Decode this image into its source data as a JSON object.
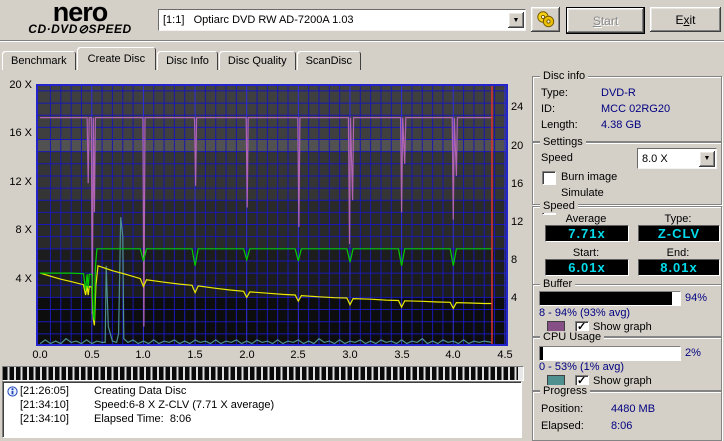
{
  "header": {
    "logo_line1": "nero",
    "logo_line2": "CD·DVD⊘SPEED",
    "drive_select_value": "[1:1]   Optiarc DVD RW AD-7200A 1.03",
    "start_parts": [
      "S",
      "tart"
    ],
    "exit_parts": [
      "E",
      "x",
      "it"
    ]
  },
  "tabs": {
    "active": "Create Disc",
    "items": [
      {
        "label": "Benchmark"
      },
      {
        "label": "Create Disc"
      },
      {
        "label": "Disc Info"
      },
      {
        "label": "Disc Quality"
      },
      {
        "label": "ScanDisc"
      }
    ]
  },
  "chart_data": {
    "type": "line",
    "x_axis": {
      "unit": "GB",
      "tick_labels": [
        "0.0",
        "0.5",
        "1.0",
        "1.5",
        "2.0",
        "2.5",
        "3.0",
        "3.5",
        "4.0",
        "4.5"
      ]
    },
    "y_left": {
      "tick_labels": [
        "20 X",
        "16 X",
        "12 X",
        "8 X",
        "4 X"
      ]
    },
    "y_right": {
      "tick_labels": [
        "24",
        "20",
        "16",
        "12",
        "8",
        "4"
      ]
    },
    "xlim": [
      -0.04,
      4.53
    ],
    "ylim": [
      0,
      21.57
    ],
    "grid": true,
    "position_marker_gb": 4.375,
    "marker_color": "#dd3333",
    "written_bar_percent": 99,
    "bands": [
      {
        "from": 21.57,
        "to": 17,
        "color": "#3f3f3f"
      },
      {
        "from": 17,
        "to": 16,
        "color": "#515151"
      },
      {
        "from": 16,
        "to": 12,
        "color": "#353535"
      },
      {
        "from": 12,
        "to": 8,
        "color": "#2a2a2a"
      },
      {
        "from": 8,
        "to": 4,
        "color": "#1d1d1d"
      },
      {
        "from": 4,
        "to": 0,
        "color": "#0d0d0d"
      }
    ],
    "series": [
      {
        "name": "buffer-level",
        "unit": "percent",
        "color": "#b164b1",
        "points": [
          [
            0,
            94
          ],
          [
            0.455,
            94
          ],
          [
            0.465,
            67
          ],
          [
            0.475,
            94
          ],
          [
            0.495,
            94
          ],
          [
            0.505,
            13
          ],
          [
            0.515,
            94
          ],
          [
            0.525,
            55
          ],
          [
            0.535,
            94
          ],
          [
            0.995,
            94
          ],
          [
            1.005,
            8
          ],
          [
            1.015,
            94
          ],
          [
            1.495,
            94
          ],
          [
            1.505,
            66
          ],
          [
            1.515,
            94
          ],
          [
            1.995,
            94
          ],
          [
            2.005,
            57
          ],
          [
            2.015,
            94
          ],
          [
            2.495,
            94
          ],
          [
            2.505,
            49
          ],
          [
            2.515,
            94
          ],
          [
            2.985,
            94
          ],
          [
            2.995,
            42
          ],
          [
            3.005,
            94
          ],
          [
            3.025,
            60
          ],
          [
            3.035,
            94
          ],
          [
            3.49,
            94
          ],
          [
            3.5,
            55
          ],
          [
            3.51,
            94
          ],
          [
            3.53,
            75
          ],
          [
            3.54,
            94
          ],
          [
            3.99,
            94
          ],
          [
            4.0,
            52
          ],
          [
            4.01,
            94
          ],
          [
            4.03,
            70
          ],
          [
            4.04,
            94
          ],
          [
            4.375,
            94
          ]
        ]
      },
      {
        "name": "cpu-usage",
        "unit": "percent",
        "color": "#4e8f8f",
        "points": [
          [
            0,
            1
          ],
          [
            0.05,
            2.5
          ],
          [
            0.1,
            1
          ],
          [
            0.15,
            2
          ],
          [
            0.2,
            1
          ],
          [
            0.25,
            3
          ],
          [
            0.3,
            1.5
          ],
          [
            0.35,
            2
          ],
          [
            0.4,
            1
          ],
          [
            0.45,
            2.5
          ],
          [
            0.5,
            1
          ],
          [
            0.55,
            2
          ],
          [
            0.6,
            1.5
          ],
          [
            0.63,
            1.5
          ],
          [
            0.64,
            33
          ],
          [
            0.66,
            8
          ],
          [
            0.7,
            2
          ],
          [
            0.74,
            1.5
          ],
          [
            0.76,
            5
          ],
          [
            0.78,
            53
          ],
          [
            0.8,
            45
          ],
          [
            0.81,
            3
          ],
          [
            0.85,
            1.5
          ],
          [
            0.9,
            2.5
          ],
          [
            0.95,
            1
          ],
          [
            1.0,
            2
          ],
          [
            1.05,
            1
          ],
          [
            1.1,
            2.5
          ],
          [
            1.15,
            1
          ],
          [
            1.2,
            2
          ],
          [
            1.25,
            1.5
          ],
          [
            1.3,
            2.5
          ],
          [
            1.35,
            1
          ],
          [
            1.4,
            2
          ],
          [
            1.45,
            1
          ],
          [
            1.5,
            2.5
          ],
          [
            1.55,
            1.5
          ],
          [
            1.6,
            2
          ],
          [
            1.65,
            1
          ],
          [
            1.7,
            2.5
          ],
          [
            1.75,
            1
          ],
          [
            1.8,
            2
          ],
          [
            1.85,
            1.5
          ],
          [
            1.9,
            2.5
          ],
          [
            1.95,
            1
          ],
          [
            2.0,
            2
          ],
          [
            2.05,
            1
          ],
          [
            2.1,
            2.5
          ],
          [
            2.15,
            1.5
          ],
          [
            2.2,
            2
          ],
          [
            2.25,
            1
          ],
          [
            2.3,
            2.5
          ],
          [
            2.35,
            1
          ],
          [
            2.4,
            2
          ],
          [
            2.45,
            1.5
          ],
          [
            2.5,
            2.5
          ],
          [
            2.55,
            1
          ],
          [
            2.6,
            2
          ],
          [
            2.65,
            1
          ],
          [
            2.7,
            3
          ],
          [
            2.75,
            1.5
          ],
          [
            2.8,
            2
          ],
          [
            2.85,
            1
          ],
          [
            2.9,
            2.5
          ],
          [
            2.95,
            1
          ],
          [
            3.0,
            2
          ],
          [
            3.05,
            1.5
          ],
          [
            3.1,
            2.5
          ],
          [
            3.15,
            1
          ],
          [
            3.2,
            2
          ],
          [
            3.25,
            1
          ],
          [
            3.3,
            2.5
          ],
          [
            3.35,
            1.5
          ],
          [
            3.4,
            2
          ],
          [
            3.45,
            1
          ],
          [
            3.5,
            2.5
          ],
          [
            3.55,
            1
          ],
          [
            3.6,
            2
          ],
          [
            3.65,
            1.5
          ],
          [
            3.7,
            3
          ],
          [
            3.75,
            1
          ],
          [
            3.8,
            2
          ],
          [
            3.85,
            1
          ],
          [
            3.9,
            2.5
          ],
          [
            3.95,
            1.5
          ],
          [
            4.0,
            2
          ],
          [
            4.05,
            1
          ],
          [
            4.1,
            2.5
          ],
          [
            4.15,
            1
          ],
          [
            4.2,
            2
          ],
          [
            4.25,
            1.5
          ],
          [
            4.3,
            2
          ],
          [
            4.375,
            1.5
          ]
        ]
      },
      {
        "name": "average-rate",
        "unit": "x",
        "color": "#e8e800",
        "points": [
          [
            0,
            6.0
          ],
          [
            0.1,
            5.75
          ],
          [
            0.2,
            5.5
          ],
          [
            0.3,
            5.3
          ],
          [
            0.42,
            5.05
          ],
          [
            0.44,
            4.2
          ],
          [
            0.455,
            4.95
          ],
          [
            0.465,
            4.2
          ],
          [
            0.475,
            4.9
          ],
          [
            0.5,
            4.85
          ],
          [
            0.515,
            2.2
          ],
          [
            0.525,
            1.7
          ],
          [
            0.54,
            5.0
          ],
          [
            0.56,
            6.6
          ],
          [
            0.7,
            6.2
          ],
          [
            0.85,
            5.85
          ],
          [
            0.97,
            5.55
          ],
          [
            1.0,
            4.9
          ],
          [
            1.03,
            5.45
          ],
          [
            1.2,
            5.25
          ],
          [
            1.35,
            5.1
          ],
          [
            1.47,
            5.0
          ],
          [
            1.5,
            4.4
          ],
          [
            1.53,
            4.95
          ],
          [
            1.7,
            4.75
          ],
          [
            1.85,
            4.6
          ],
          [
            1.97,
            4.5
          ],
          [
            2.0,
            4.0
          ],
          [
            2.03,
            4.45
          ],
          [
            2.2,
            4.35
          ],
          [
            2.35,
            4.25
          ],
          [
            2.47,
            4.2
          ],
          [
            2.5,
            3.7
          ],
          [
            2.53,
            4.15
          ],
          [
            2.7,
            4.05
          ],
          [
            2.85,
            3.98
          ],
          [
            2.97,
            3.95
          ],
          [
            3.0,
            3.4
          ],
          [
            3.03,
            3.9
          ],
          [
            3.2,
            3.85
          ],
          [
            3.35,
            3.78
          ],
          [
            3.47,
            3.75
          ],
          [
            3.5,
            3.2
          ],
          [
            3.53,
            3.72
          ],
          [
            3.7,
            3.68
          ],
          [
            3.85,
            3.62
          ],
          [
            3.97,
            3.6
          ],
          [
            4.0,
            3.1
          ],
          [
            4.03,
            3.57
          ],
          [
            4.2,
            3.53
          ],
          [
            4.3,
            3.5
          ],
          [
            4.375,
            3.5
          ]
        ]
      },
      {
        "name": "write-speed",
        "unit": "x",
        "color": "#00cc00",
        "points": [
          [
            0,
            6.0
          ],
          [
            0.1,
            6.0
          ],
          [
            0.2,
            6.0
          ],
          [
            0.3,
            6.0
          ],
          [
            0.42,
            5.95
          ],
          [
            0.44,
            4.6
          ],
          [
            0.455,
            5.9
          ],
          [
            0.465,
            4.8
          ],
          [
            0.475,
            5.9
          ],
          [
            0.5,
            5.9
          ],
          [
            0.515,
            2.6
          ],
          [
            0.525,
            2.1
          ],
          [
            0.535,
            6.5
          ],
          [
            0.55,
            8.0
          ],
          [
            0.97,
            8.0
          ],
          [
            1.0,
            7.0
          ],
          [
            1.03,
            8.0
          ],
          [
            1.47,
            8.0
          ],
          [
            1.5,
            6.6
          ],
          [
            1.53,
            8.0
          ],
          [
            1.97,
            8.0
          ],
          [
            2.0,
            7.1
          ],
          [
            2.03,
            8.0
          ],
          [
            2.47,
            8.0
          ],
          [
            2.5,
            7.0
          ],
          [
            2.53,
            8.0
          ],
          [
            2.97,
            8.0
          ],
          [
            3.0,
            6.9
          ],
          [
            3.03,
            8.0
          ],
          [
            3.47,
            8.0
          ],
          [
            3.5,
            6.6
          ],
          [
            3.53,
            8.0
          ],
          [
            3.97,
            8.0
          ],
          [
            4.0,
            6.6
          ],
          [
            4.03,
            8.0
          ],
          [
            4.375,
            8.0
          ]
        ]
      }
    ]
  },
  "log": {
    "lines": [
      {
        "time": "[21:26:05]",
        "text": "Creating Data Disc"
      },
      {
        "time": "[21:34:10]",
        "text": "Speed:6-8 X Z-CLV (7.71 X average)"
      },
      {
        "time": "[21:34:10]",
        "text": "Elapsed Time:  8:06"
      }
    ]
  },
  "disc_info": {
    "title": "Disc info",
    "rows": [
      {
        "label": "Type:",
        "value": "DVD-R"
      },
      {
        "label": "ID:",
        "value": "MCC 02RG20"
      },
      {
        "label": "Length:",
        "value": "4.38 GB"
      }
    ]
  },
  "settings": {
    "title": "Settings",
    "speed_label": "Speed",
    "speed_value": "8.0 X",
    "checkboxes": [
      {
        "label": "Burn image",
        "checked": false
      },
      {
        "label": "Simulate",
        "checked": false
      }
    ]
  },
  "speed": {
    "title": "Speed",
    "average_label": "Average",
    "average_value": "7.71x",
    "type_label": "Type:",
    "type_value": "Z-CLV",
    "start_label": "Start:",
    "start_value": "6.01x",
    "end_label": "End:",
    "end_value": "8.01x"
  },
  "buffer": {
    "title": "Buffer",
    "percent": 94,
    "percent_label": "94%",
    "range_text": "8 - 94% (93% avg)",
    "swatch_color": "#864f86",
    "show_graph_label": "Show graph",
    "show_graph_checked": true
  },
  "cpu": {
    "title": "CPU Usage",
    "percent": 2,
    "percent_label": "2%",
    "range_text": "0 - 53% (1% avg)",
    "swatch_color": "#4e8f8f",
    "show_graph_label": "Show graph",
    "show_graph_checked": true
  },
  "progress": {
    "title": "Progress",
    "position_label": "Position:",
    "position_value": "4480 MB",
    "elapsed_label": "Elapsed:",
    "elapsed_value": "8:06"
  }
}
